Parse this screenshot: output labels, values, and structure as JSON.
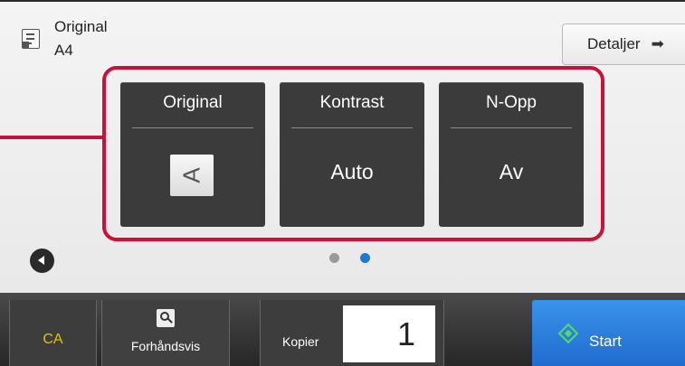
{
  "header": {
    "title": "Original",
    "paper_size": "A4",
    "details_label": "Detaljer",
    "details_icon": "arrow-right-icon",
    "doc_icon": "document-icon"
  },
  "tiles": [
    {
      "label": "Original",
      "value_icon": "orientation-icon",
      "glyph": "A"
    },
    {
      "label": "Kontrast",
      "value": "Auto"
    },
    {
      "label": "N-Opp",
      "value": "Av"
    }
  ],
  "pager": {
    "pages": 2,
    "current_page": 2,
    "prev_icon": "chevron-left-icon"
  },
  "bottom": {
    "ca_label": "CA",
    "preview_label": "Forhåndsvis",
    "preview_icon": "magnifier-icon",
    "copies_label": "Kopier",
    "copies_value": "1",
    "start_label": "Start",
    "start_icon": "diamond-start-icon"
  },
  "colors": {
    "highlight": "#c9123a",
    "tile_bg": "#3b3b3b",
    "start_bg": "#2b82e0",
    "ca_text": "#e8c200",
    "active_dot": "#1e77d3"
  }
}
